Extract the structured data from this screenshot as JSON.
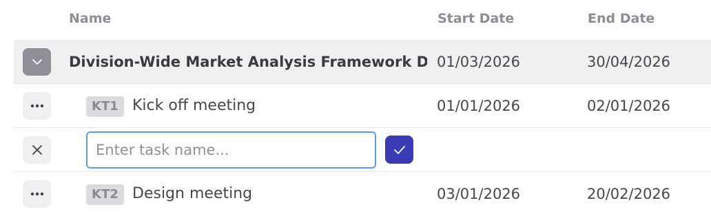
{
  "header": {
    "name": "Name",
    "start_date": "Start Date",
    "end_date": "End Date"
  },
  "group_row": {
    "name": "Division-Wide Market Analysis Framework Development",
    "start_date": "01/03/2026",
    "end_date": "30/04/2026",
    "toggle_icon": "chevron-down-icon"
  },
  "tasks": [
    {
      "tag": "KT1",
      "name": "Kick off meeting",
      "start_date": "01/01/2026",
      "end_date": "02/01/2026",
      "menu_icon": "more-horizontal-icon"
    },
    {
      "tag": "KT2",
      "name": "Design meeting",
      "start_date": "03/01/2026",
      "end_date": "20/02/2026",
      "menu_icon": "more-horizontal-icon"
    }
  ],
  "new_task": {
    "placeholder": "Enter task name...",
    "value": "",
    "cancel_icon": "close-icon",
    "confirm_icon": "check-icon"
  },
  "colors": {
    "accent": "#3b3bb5",
    "input_focus_border": "#5b9be6",
    "group_row_bg": "#f0f0f2"
  }
}
